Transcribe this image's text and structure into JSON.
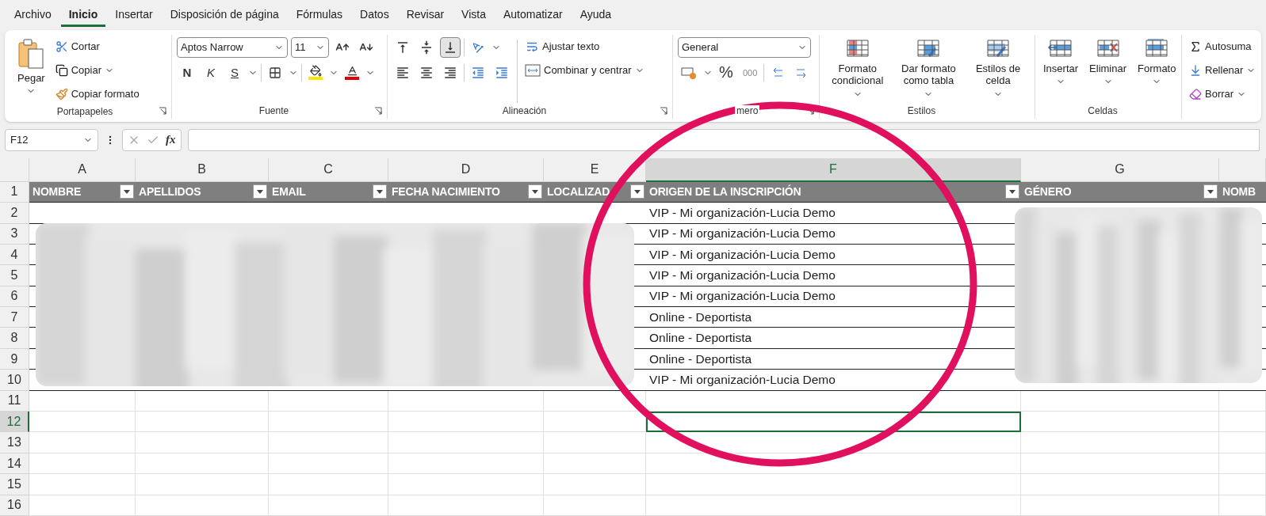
{
  "menu_tabs": [
    {
      "label": "Archivo",
      "selected": false
    },
    {
      "label": "Inicio",
      "selected": true
    },
    {
      "label": "Insertar",
      "selected": false
    },
    {
      "label": "Disposición de página",
      "selected": false
    },
    {
      "label": "Fórmulas",
      "selected": false
    },
    {
      "label": "Datos",
      "selected": false
    },
    {
      "label": "Revisar",
      "selected": false
    },
    {
      "label": "Vista",
      "selected": false
    },
    {
      "label": "Automatizar",
      "selected": false
    },
    {
      "label": "Ayuda",
      "selected": false
    }
  ],
  "ribbon": {
    "clipboard": {
      "label": "Portapapeles",
      "paste": "Pegar",
      "cut": "Cortar",
      "copy": "Copiar",
      "format_painter": "Copiar formato"
    },
    "font": {
      "label": "Fuente",
      "font_name": "Aptos Narrow",
      "font_size": "11",
      "bold": "N",
      "italic": "K",
      "underline": "S"
    },
    "alignment": {
      "label": "Alineación",
      "vertical_align": [
        {
          "kind": "top",
          "selected": false
        },
        {
          "kind": "middle",
          "selected": false
        },
        {
          "kind": "bottom",
          "selected": true
        }
      ],
      "wrap_text": "Ajustar texto",
      "merge_center": "Combinar y centrar"
    },
    "number": {
      "label": "mero",
      "format": "General",
      "percent": "%",
      "thousands": "000"
    },
    "styles": {
      "label": "Estilos",
      "buttons": [
        {
          "kind": "conditional",
          "label": "Formato condicional"
        },
        {
          "kind": "table",
          "label": "Dar formato como tabla"
        },
        {
          "kind": "cell",
          "label": "Estilos de celda"
        }
      ]
    },
    "cells": {
      "label": "Celdas",
      "buttons": [
        {
          "kind": "insert",
          "label": "Insertar"
        },
        {
          "kind": "delete",
          "label": "Eliminar"
        },
        {
          "kind": "format",
          "label": "Formato"
        }
      ]
    },
    "editing": {
      "autosum": "Autosuma",
      "fill": "Rellenar",
      "clear": "Borrar"
    }
  },
  "name_box": "F12",
  "formula_bar": {
    "fx": "fx"
  },
  "columns": [
    {
      "label": "A",
      "selected": false
    },
    {
      "label": "B",
      "selected": false
    },
    {
      "label": "C",
      "selected": false
    },
    {
      "label": "D",
      "selected": false
    },
    {
      "label": "E",
      "selected": false
    },
    {
      "label": "F",
      "selected": true
    },
    {
      "label": "G",
      "selected": false
    }
  ],
  "rows": [
    {
      "label": "1",
      "selected": false
    },
    {
      "label": "2",
      "selected": false
    },
    {
      "label": "3",
      "selected": false
    },
    {
      "label": "4",
      "selected": false
    },
    {
      "label": "5",
      "selected": false
    },
    {
      "label": "6",
      "selected": false
    },
    {
      "label": "7",
      "selected": false
    },
    {
      "label": "8",
      "selected": false
    },
    {
      "label": "9",
      "selected": false
    },
    {
      "label": "10",
      "selected": false
    },
    {
      "label": "11",
      "selected": false
    },
    {
      "label": "12",
      "selected": true
    },
    {
      "label": "13",
      "selected": false
    },
    {
      "label": "14",
      "selected": false
    },
    {
      "label": "15",
      "selected": false
    },
    {
      "label": "16",
      "selected": false
    }
  ],
  "table": {
    "headers": [
      "NOMBRE",
      "APELLIDOS",
      "EMAIL",
      "FECHA NACIMIENTO",
      "LOCALIZAD",
      "ORIGEN DE LA INSCRIPCIÓN",
      "GÉNERO",
      "NOMB"
    ],
    "rows": [
      {
        "origen_de_la_inscripcion": "VIP - Mi organización-Lucia Demo"
      },
      {
        "origen_de_la_inscripcion": "VIP - Mi organización-Lucia Demo"
      },
      {
        "origen_de_la_inscripcion": "VIP - Mi organización-Lucia Demo"
      },
      {
        "origen_de_la_inscripcion": "VIP - Mi organización-Lucia Demo"
      },
      {
        "origen_de_la_inscripcion": "VIP - Mi organización-Lucia Demo"
      },
      {
        "origen_de_la_inscripcion": "Online - Deportista"
      },
      {
        "origen_de_la_inscripcion": "Online - Deportista"
      },
      {
        "origen_de_la_inscripcion": "Online - Deportista"
      },
      {
        "origen_de_la_inscripcion": "VIP - Mi organización-Lucia Demo"
      }
    ]
  }
}
